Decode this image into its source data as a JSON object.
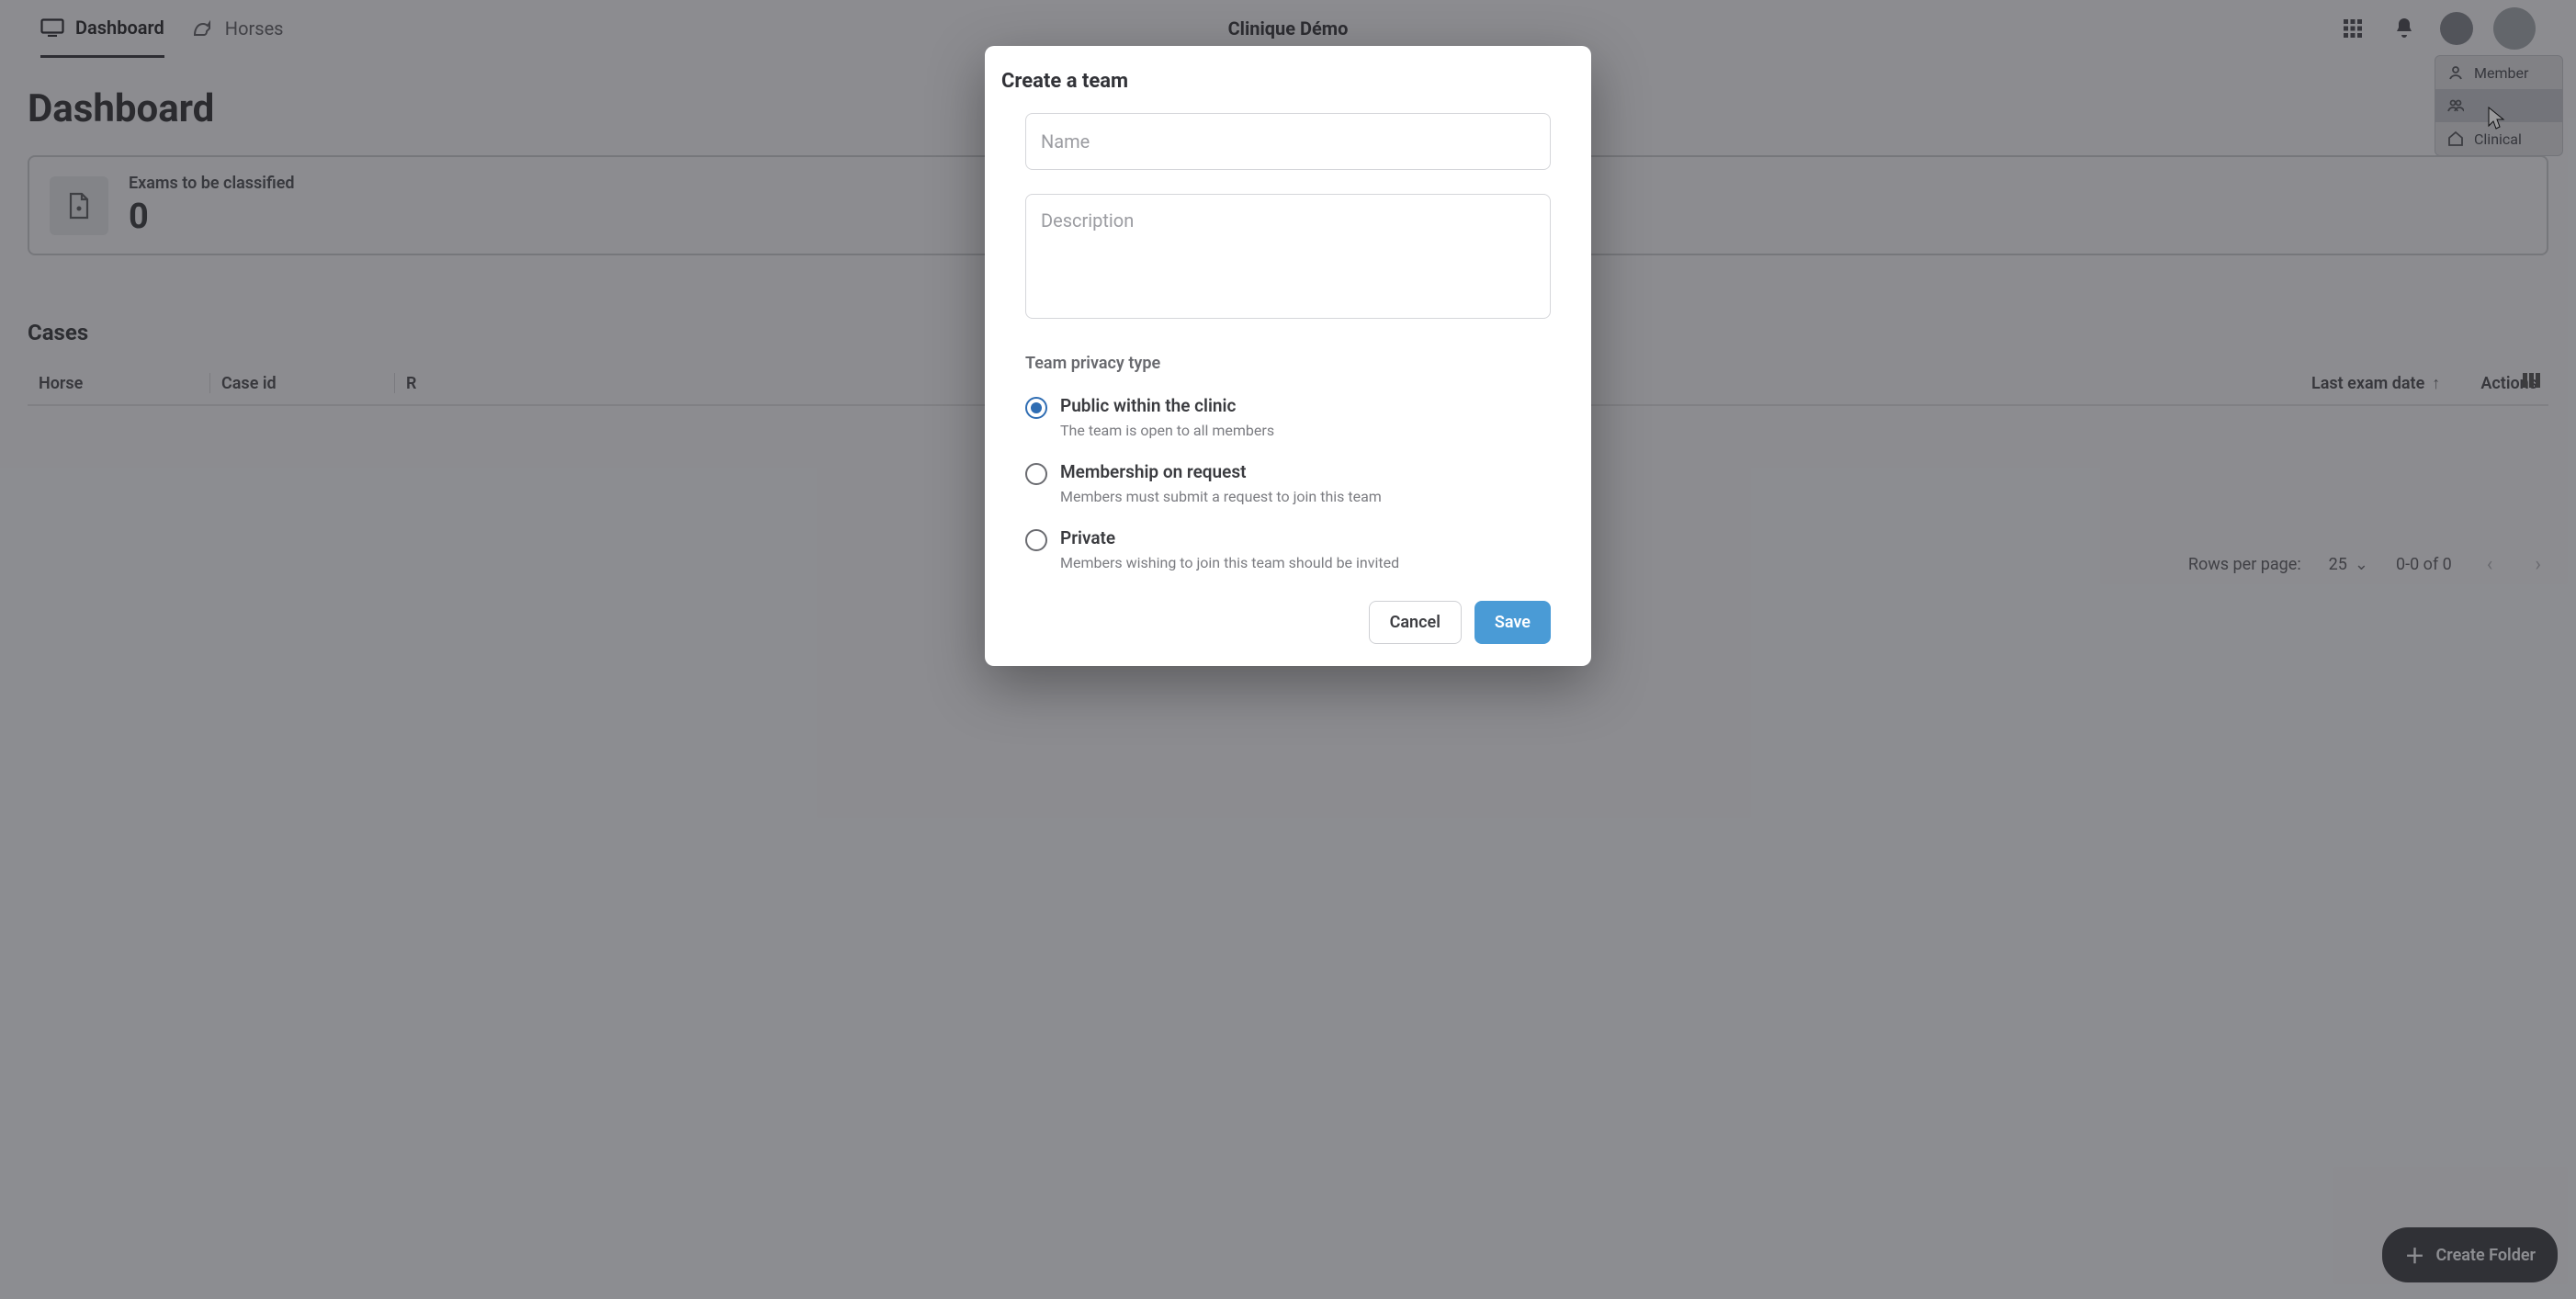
{
  "nav": {
    "tabs": [
      {
        "icon": "monitor-icon",
        "label": "Dashboard",
        "active": true
      },
      {
        "icon": "horse-icon",
        "label": "Horses",
        "active": false
      }
    ],
    "title": "Clinique Démo"
  },
  "dropdown": {
    "items": [
      {
        "label": "Member"
      },
      {
        "label": ""
      },
      {
        "label": "Clinical"
      }
    ],
    "active_index": 1
  },
  "page": {
    "title": "Dashboard",
    "stat": {
      "label": "Exams to be classified",
      "value": "0"
    },
    "cases": {
      "title": "Cases",
      "columns": {
        "horse": "Horse",
        "caseid": "Case id",
        "r": "R",
        "lastdate": "Last exam date",
        "actions": "Actions"
      },
      "paginator": {
        "rows_label": "Rows per page:",
        "rows_value": "25",
        "range": "0-0 of 0"
      }
    },
    "fab_label": "Create Folder"
  },
  "modal": {
    "title": "Create a team",
    "name_placeholder": "Name",
    "desc_placeholder": "Description",
    "privacy_label": "Team privacy type",
    "options": [
      {
        "title": "Public within the clinic",
        "desc": "The team is open to all members",
        "selected": true
      },
      {
        "title": "Membership on request",
        "desc": "Members must submit a request to join this team",
        "selected": false
      },
      {
        "title": "Private",
        "desc": "Members wishing to join this team should be invited",
        "selected": false
      }
    ],
    "cancel": "Cancel",
    "save": "Save"
  }
}
